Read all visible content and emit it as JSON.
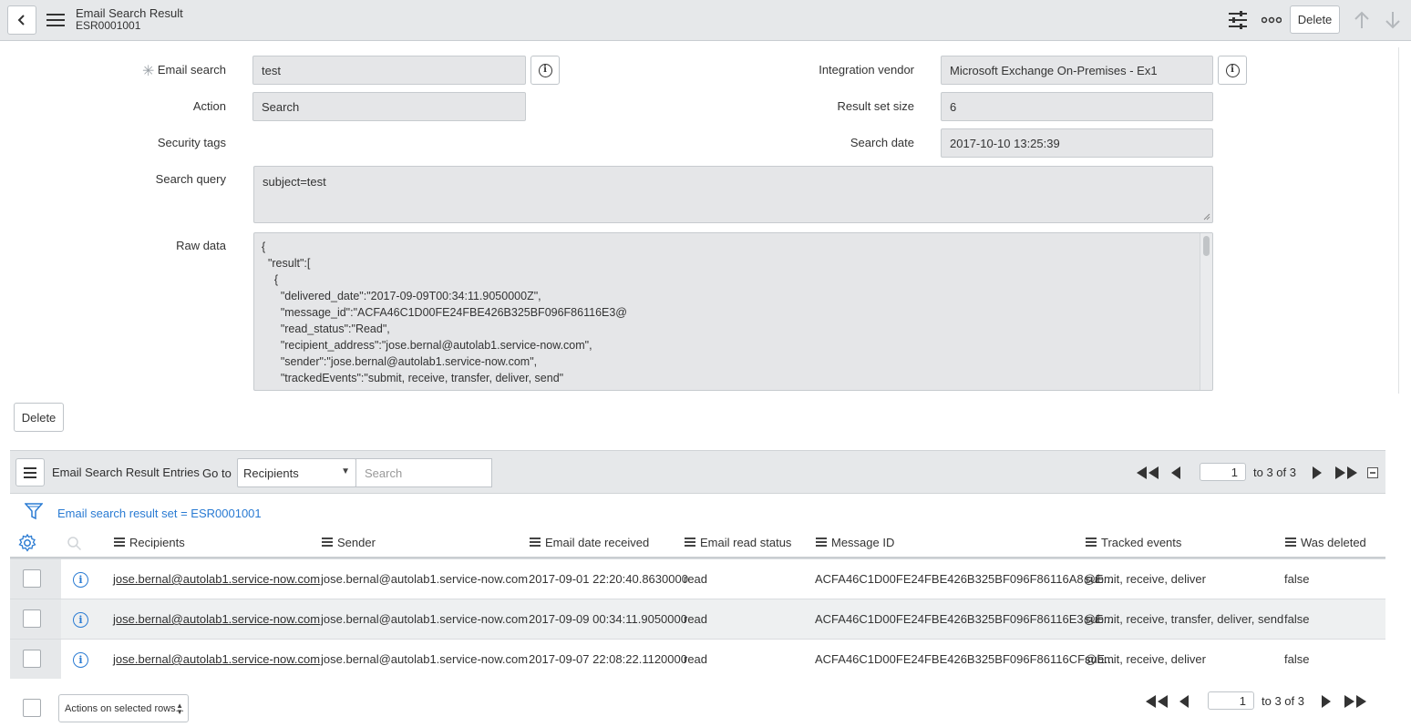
{
  "header": {
    "title": "Email Search Result",
    "record_number": "ESR0001001",
    "delete_label": "Delete"
  },
  "form": {
    "email_search_label": "Email search",
    "email_search_value": "test",
    "action_label": "Action",
    "action_value": "Search",
    "security_tags_label": "Security tags",
    "search_query_label": "Search query",
    "search_query_value": "subject=test",
    "raw_data_label": "Raw data",
    "raw_data_lines": [
      "{",
      "  \"result\":[",
      "    {",
      "      \"delivered_date\":\"2017-09-09T00:34:11.9050000Z\",",
      "      \"message_id\":\"ACFA46C1D00FE24FBE426B325BF096F86116E3@",
      "      \"read_status\":\"Read\",",
      "      \"recipient_address\":\"jose.bernal@autolab1.service-now.com\",",
      "      \"sender\":\"jose.bernal@autolab1.service-now.com\",",
      "      \"trackedEvents\":\"submit, receive, transfer, deliver, send\""
    ],
    "integration_vendor_label": "Integration vendor",
    "integration_vendor_value": "Microsoft Exchange On-Premises - Ex1",
    "result_set_size_label": "Result set size",
    "result_set_size_value": "6",
    "search_date_label": "Search date",
    "search_date_value": "2017-10-10 13:25:39",
    "delete_label": "Delete"
  },
  "related_list": {
    "title": "Email Search Result Entries",
    "goto_label": "Go to",
    "goto_selected": "Recipients",
    "search_placeholder": "Search",
    "page_value": "1",
    "page_range": "to 3 of 3",
    "filter_text": "Email search result set = ESR0001001",
    "columns": [
      "Recipients",
      "Sender",
      "Email date received",
      "Email read status",
      "Message ID",
      "Tracked events",
      "Was deleted"
    ],
    "rows": [
      {
        "recipients": "jose.bernal@autolab1.service-now.com",
        "sender": "jose.bernal@autolab1.service-now.com",
        "date": "2017-09-01 22:20:40.8630000",
        "status": "read",
        "message_id": "ACFA46C1D00FE24FBE426B325BF096F86116A8@E...",
        "events": "submit, receive, deliver",
        "deleted": "false"
      },
      {
        "recipients": "jose.bernal@autolab1.service-now.com",
        "sender": "jose.bernal@autolab1.service-now.com",
        "date": "2017-09-09 00:34:11.9050000",
        "status": "read",
        "message_id": "ACFA46C1D00FE24FBE426B325BF096F86116E3@E...",
        "events": "submit, receive, transfer, deliver, send",
        "deleted": "false"
      },
      {
        "recipients": "jose.bernal@autolab1.service-now.com",
        "sender": "jose.bernal@autolab1.service-now.com",
        "date": "2017-09-07 22:08:22.1120000",
        "status": "read",
        "message_id": "ACFA46C1D00FE24FBE426B325BF096F86116CF@E...",
        "events": "submit, receive, deliver",
        "deleted": "false"
      }
    ],
    "actions_label": "Actions on selected rows...",
    "footer_page_value": "1",
    "footer_page_range": "to 3 of 3"
  },
  "colors": {
    "header_bg": "#e6e8ea",
    "field_bg": "#e5e6e8",
    "link_blue": "#2a7bd3",
    "alt_row": "#eef0f1"
  }
}
